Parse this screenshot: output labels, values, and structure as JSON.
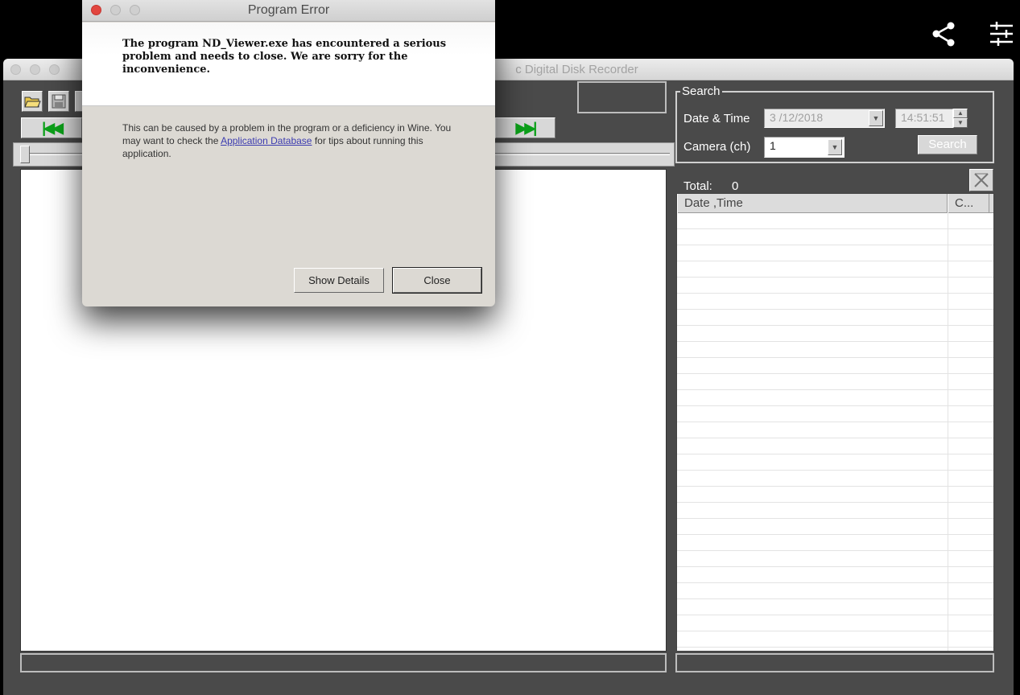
{
  "overlay": {
    "share_icon": "share-icon",
    "settings_icon": "sliders-icon"
  },
  "main_window": {
    "title": "c Digital Disk Recorder",
    "toolbar": {
      "open_icon": "folder-open-icon",
      "save_icon": "save-icon"
    },
    "nav": {
      "first_label": "|◀◀",
      "last_label": "▶▶|"
    }
  },
  "search": {
    "legend": "Search",
    "date_time_label": "Date & Time",
    "date_value": "3 /12/2018",
    "time_value": "14:51:51",
    "camera_label": "Camera (ch)",
    "camera_value": "1",
    "search_button": "Search"
  },
  "results": {
    "total_label": "Total:",
    "total_value": "0",
    "columns": [
      "Date ,Time",
      "C..."
    ]
  },
  "error_dialog": {
    "title": "Program Error",
    "message": "The program ND_Viewer.exe has encountered a serious problem and needs to close. We are sorry for the inconvenience.",
    "detail_before_link": "This can be caused by a problem in the program or a deficiency in Wine. You may want to check the ",
    "detail_link": "Application Database",
    "detail_after_link": " for tips about running this application.",
    "show_details_button": "Show Details",
    "close_button": "Close"
  }
}
